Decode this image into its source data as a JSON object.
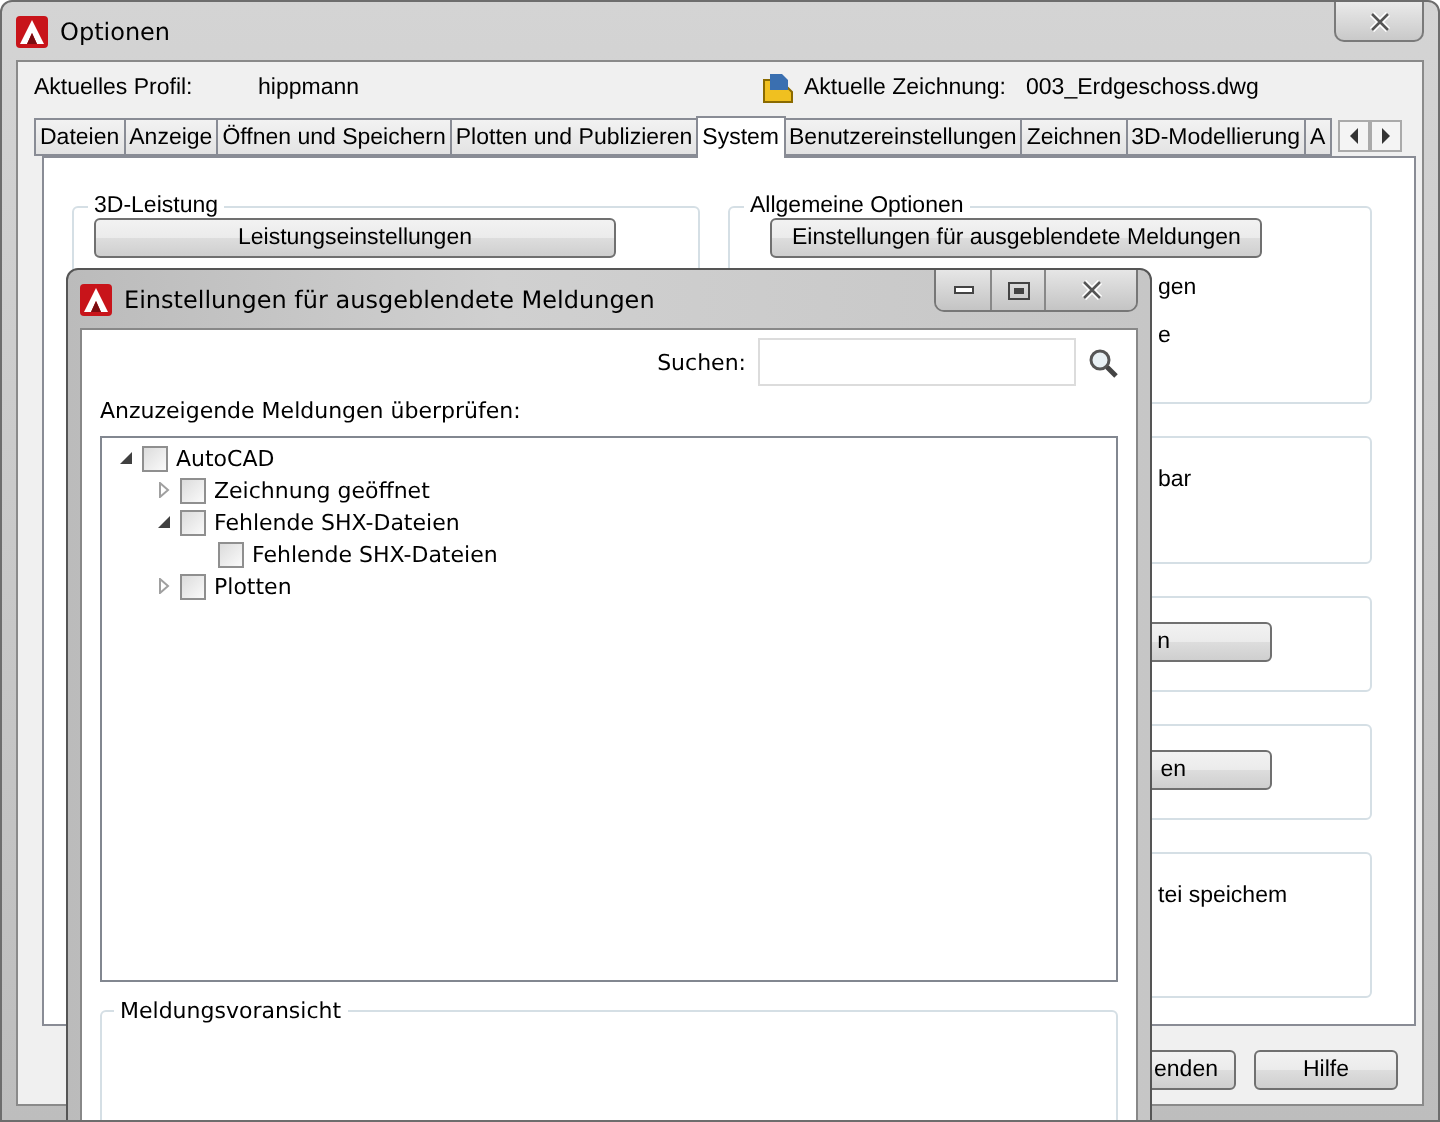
{
  "window": {
    "title": "Optionen"
  },
  "profile": {
    "label": "Aktuelles Profil:",
    "value": "hippmann"
  },
  "drawing": {
    "label": "Aktuelle Zeichnung:",
    "value": "003_Erdgeschoss.dwg"
  },
  "tabs": [
    {
      "label": "Dateien",
      "selected": false
    },
    {
      "label": "Anzeige",
      "selected": false
    },
    {
      "label": "Öffnen und Speichern",
      "selected": false
    },
    {
      "label": "Plotten und Publizieren",
      "selected": false
    },
    {
      "label": "System",
      "selected": true
    },
    {
      "label": "Benutzereinstellungen",
      "selected": false
    },
    {
      "label": "Zeichnen",
      "selected": false
    },
    {
      "label": "3D-Modellierung",
      "selected": false
    },
    {
      "label": "A",
      "selected": false
    }
  ],
  "left_group": {
    "title": "3D-Leistung",
    "button": "Leistungseinstellungen"
  },
  "right_groups": [
    {
      "title": "Allgemeine Optionen",
      "button": "Einstellungen für ausgeblendete Meldungen",
      "texts": [
        "gen",
        "e"
      ]
    },
    {
      "texts": [
        "bar"
      ]
    },
    {
      "button": "n"
    },
    {
      "button": "en"
    },
    {
      "texts": [
        "tei speichem"
      ]
    }
  ],
  "footer_buttons": [
    "enden",
    "Hilfe"
  ],
  "dialog": {
    "title": "Einstellungen für ausgeblendete Meldungen",
    "search_label": "Suchen:",
    "instruction": "Anzuzeigende Meldungen überprüfen:",
    "tree": [
      {
        "label": "AutoCAD",
        "checked": false,
        "expanded": true,
        "children": [
          {
            "label": "Zeichnung geöffnet",
            "checked": false,
            "expanded": false
          },
          {
            "label": "Fehlende SHX-Dateien",
            "checked": false,
            "expanded": true,
            "children": [
              {
                "label": "Fehlende SHX-Dateien",
                "checked": false
              }
            ]
          },
          {
            "label": "Plotten",
            "checked": false,
            "expanded": false
          }
        ]
      }
    ],
    "preview_title": "Meldungsvoransicht"
  }
}
